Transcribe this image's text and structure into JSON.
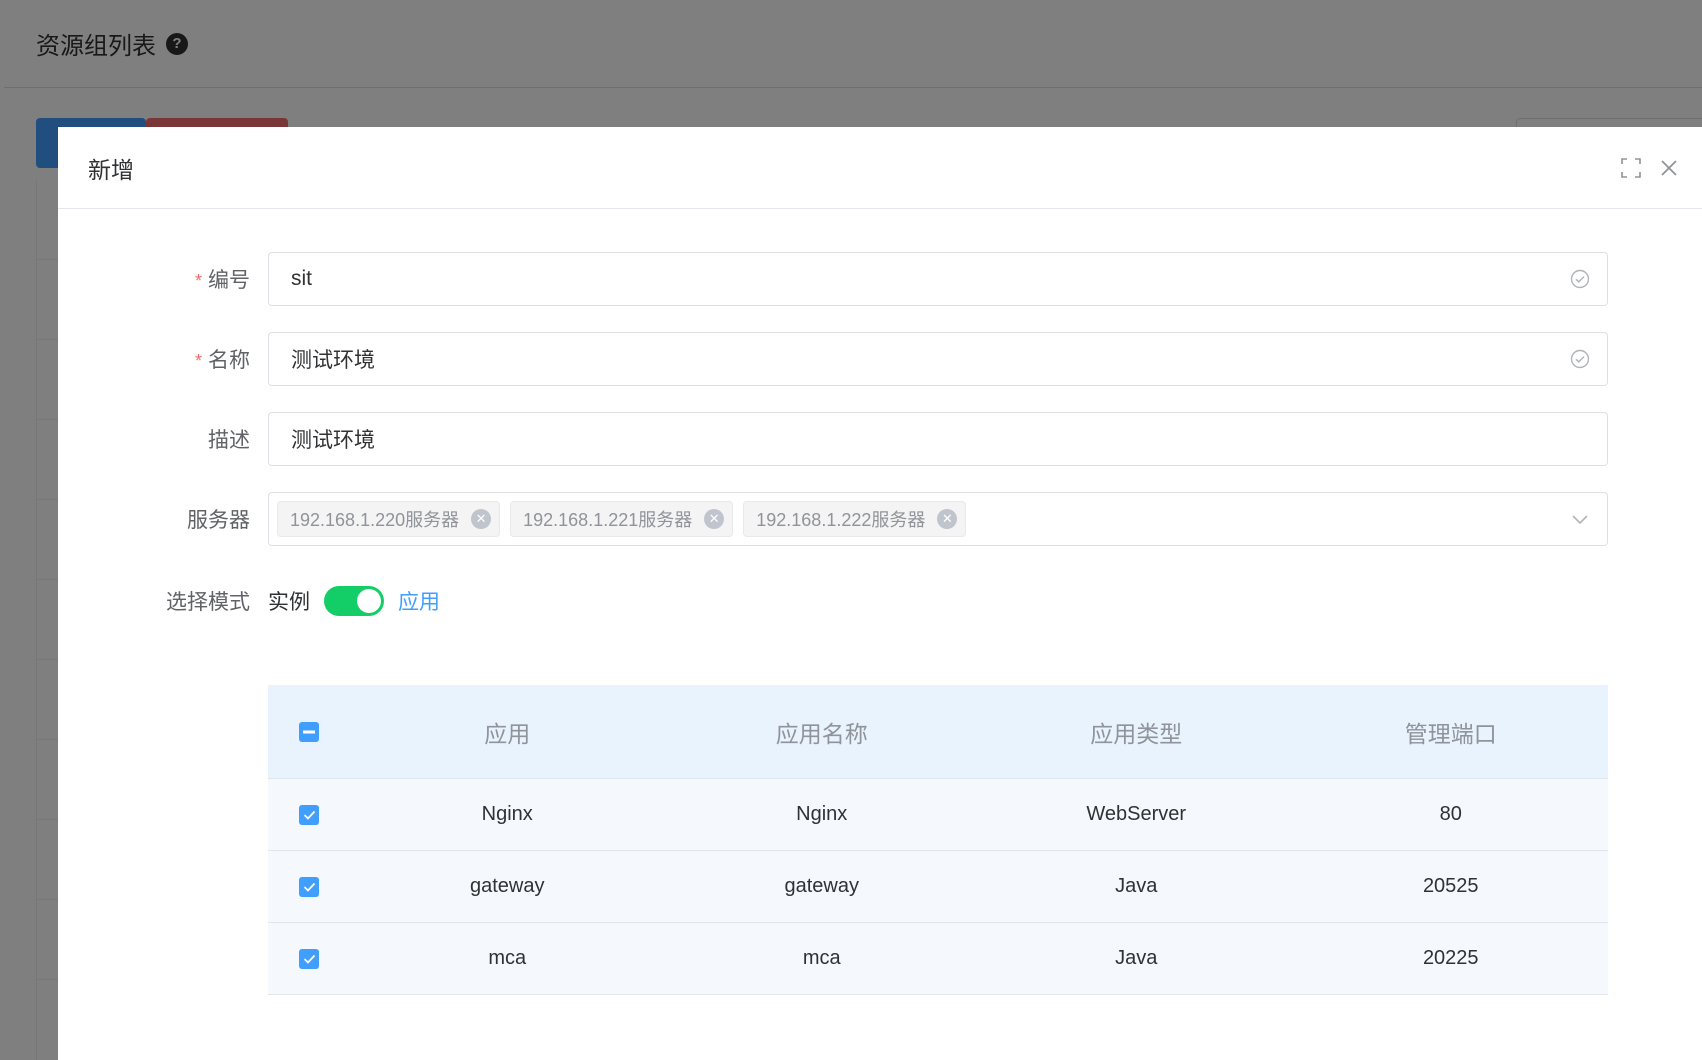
{
  "background": {
    "title": "资源组列表",
    "help_icon": "question-circle-icon"
  },
  "dialog": {
    "title": "新增",
    "fullscreen_icon": "fullscreen-icon",
    "close_icon": "close-icon"
  },
  "form": {
    "code": {
      "label": "编号",
      "value": "sit",
      "required": true
    },
    "name": {
      "label": "名称",
      "value": "测试环境",
      "required": true
    },
    "description": {
      "label": "描述",
      "value": "测试环境"
    },
    "servers": {
      "label": "服务器",
      "tags": [
        "192.168.1.220服务器",
        "192.168.1.221服务器",
        "192.168.1.222服务器"
      ]
    },
    "mode": {
      "label": "选择模式",
      "left_text": "实例",
      "right_text": "应用",
      "on": true
    }
  },
  "table": {
    "columns": [
      "应用",
      "应用名称",
      "应用类型",
      "管理端口"
    ],
    "rows": [
      {
        "app": "Nginx",
        "app_name": "Nginx",
        "type": "WebServer",
        "port": "80",
        "checked": true
      },
      {
        "app": "gateway",
        "app_name": "gateway",
        "type": "Java",
        "port": "20525",
        "checked": true
      },
      {
        "app": "mca",
        "app_name": "mca",
        "type": "Java",
        "port": "20225",
        "checked": true
      }
    ]
  },
  "colors": {
    "primary": "#409eff",
    "switch_on": "#13ce66",
    "required": "#f56c6c",
    "table_header_bg": "#e8f3fe"
  }
}
